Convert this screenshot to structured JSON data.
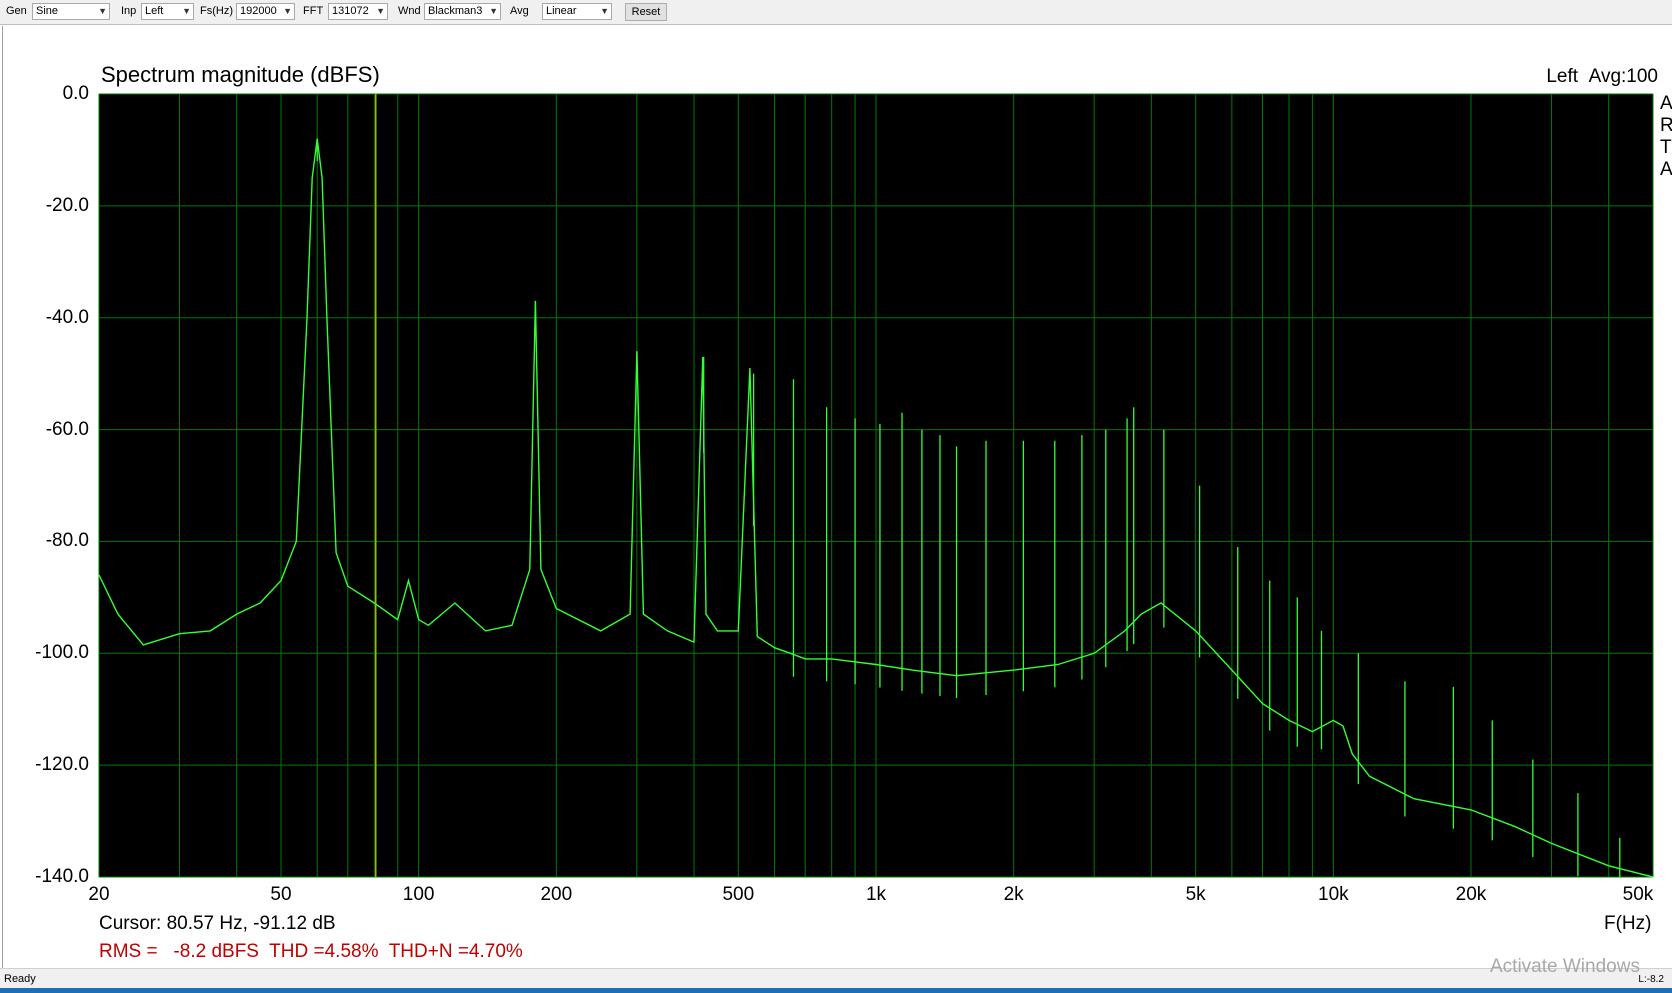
{
  "toolbar": {
    "gen": {
      "label": "Gen",
      "value": "Sine"
    },
    "inp": {
      "label": "Inp",
      "value": "Left"
    },
    "fs": {
      "label": "Fs(Hz)",
      "value": "192000"
    },
    "fft": {
      "label": "FFT",
      "value": "131072"
    },
    "wnd": {
      "label": "Wnd",
      "value": "Blackman3"
    },
    "avg": {
      "label": "Avg",
      "value": "Linear"
    },
    "reset_label": "Reset"
  },
  "header": {
    "title": "Spectrum magnitude (dBFS)",
    "channel": "Left",
    "avg_status": "Avg:100",
    "side_letters": [
      "A",
      "R",
      "T",
      "A"
    ]
  },
  "readout": {
    "cursor": "Cursor: 80.57 Hz, -91.12 dB",
    "measurements": "RMS =   -8.2 dBFS  THD =4.58%  THD+N =4.70%",
    "x_unit": "F(Hz)"
  },
  "status": {
    "ready": "Ready",
    "right": "L:-8.2",
    "watermark": "Activate Windows"
  },
  "colors": {
    "plot_bg": "#000000",
    "grid": "#007a00",
    "trace": "#33ff33",
    "cursor": "#b0b000",
    "meas": "#c00000"
  },
  "chart_data": {
    "type": "line",
    "title": "Spectrum magnitude (dBFS)",
    "xlabel": "F(Hz)",
    "ylabel": "",
    "x_scale": "log",
    "xlim": [
      20,
      50000
    ],
    "ylim": [
      -140,
      0
    ],
    "grid": true,
    "x_tick_labels": [
      {
        "v": 20,
        "t": "20"
      },
      {
        "v": 50,
        "t": "50"
      },
      {
        "v": 100,
        "t": "100"
      },
      {
        "v": 200,
        "t": "200"
      },
      {
        "v": 500,
        "t": "500"
      },
      {
        "v": 1000,
        "t": "1k"
      },
      {
        "v": 2000,
        "t": "2k"
      },
      {
        "v": 5000,
        "t": "5k"
      },
      {
        "v": 10000,
        "t": "10k"
      },
      {
        "v": 20000,
        "t": "20k"
      },
      {
        "v": 50000,
        "t": "50k"
      }
    ],
    "y_tick_labels": [
      {
        "v": 0,
        "t": "0.0"
      },
      {
        "v": -20,
        "t": "-20.0"
      },
      {
        "v": -40,
        "t": "-40.0"
      },
      {
        "v": -60,
        "t": "-60.0"
      },
      {
        "v": -80,
        "t": "-80.0"
      },
      {
        "v": -100,
        "t": "-100.0"
      },
      {
        "v": -120,
        "t": "-120.0"
      },
      {
        "v": -140,
        "t": "-140.0"
      }
    ],
    "cursor": {
      "x": 80.57,
      "y": -91.12
    },
    "series": [
      {
        "x": [
          20,
          22,
          25,
          30,
          35,
          40,
          45,
          50,
          54,
          57,
          58.5,
          60,
          61.5,
          63,
          66,
          70,
          80,
          90,
          95,
          100,
          105,
          120,
          140,
          160,
          175,
          180,
          185,
          200,
          250,
          290,
          300,
          310,
          350,
          400,
          418,
          425,
          450,
          500,
          530,
          550,
          600,
          650,
          700,
          800,
          1000,
          1200,
          1500,
          2000,
          2500,
          3000,
          3500,
          3800,
          4200,
          5000,
          6000,
          7000,
          8000,
          9000,
          10000,
          10500,
          11000,
          12000,
          15000,
          20000,
          25000,
          30000,
          40000,
          50000
        ],
        "values": [
          -86,
          -93,
          -98.5,
          -96.5,
          -96,
          -93,
          -91,
          -87,
          -80,
          -40,
          -15,
          -8,
          -15,
          -40,
          -82,
          -88,
          -91,
          -94,
          -87,
          -94,
          -95,
          -91,
          -96,
          -95,
          -85,
          -37,
          -85,
          -92,
          -96,
          -93,
          -46,
          -93,
          -96,
          -98,
          -47,
          -93,
          -96,
          -96,
          -49,
          -97,
          -99,
          -100,
          -101,
          -101,
          -102,
          -103,
          -104,
          -103,
          -102,
          -100,
          -96,
          -93,
          -91,
          -96,
          -103,
          -109,
          -112,
          -114,
          -112,
          -113,
          -118,
          -122,
          -126,
          -128,
          -131,
          -134,
          -138,
          -140
        ]
      }
    ],
    "harmonics": [
      {
        "x": 60,
        "y": -8
      },
      {
        "x": 180,
        "y": -37
      },
      {
        "x": 300,
        "y": -46
      },
      {
        "x": 420,
        "y": -47
      },
      {
        "x": 540,
        "y": -50
      },
      {
        "x": 660,
        "y": -51
      },
      {
        "x": 780,
        "y": -56
      },
      {
        "x": 900,
        "y": -58
      },
      {
        "x": 1020,
        "y": -59
      },
      {
        "x": 1140,
        "y": -57
      },
      {
        "x": 1260,
        "y": -60
      },
      {
        "x": 1380,
        "y": -61
      },
      {
        "x": 1500,
        "y": -63
      },
      {
        "x": 1740,
        "y": -62
      },
      {
        "x": 2100,
        "y": -62
      },
      {
        "x": 2460,
        "y": -62
      },
      {
        "x": 2820,
        "y": -61
      },
      {
        "x": 3180,
        "y": -60
      },
      {
        "x": 3540,
        "y": -58
      },
      {
        "x": 3660,
        "y": -56
      },
      {
        "x": 4260,
        "y": -60
      },
      {
        "x": 5100,
        "y": -70
      },
      {
        "x": 6180,
        "y": -81
      },
      {
        "x": 7260,
        "y": -87
      },
      {
        "x": 8340,
        "y": -90
      },
      {
        "x": 9420,
        "y": -96
      },
      {
        "x": 11340,
        "y": -100
      },
      {
        "x": 14340,
        "y": -105
      },
      {
        "x": 18300,
        "y": -106
      },
      {
        "x": 22260,
        "y": -112
      },
      {
        "x": 27300,
        "y": -119
      },
      {
        "x": 34260,
        "y": -125
      },
      {
        "x": 42300,
        "y": -133
      }
    ]
  }
}
